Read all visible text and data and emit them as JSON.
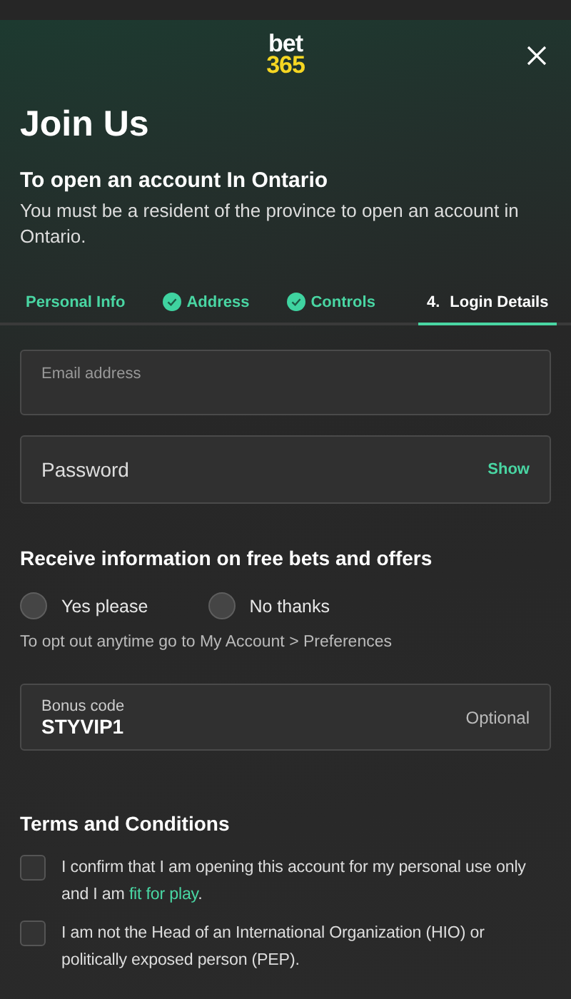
{
  "logo": {
    "line_1": "bet",
    "line_2": "365"
  },
  "title": "Join Us",
  "notice": {
    "heading": "To open an account In Ontario",
    "text": "You must be a resident of the province to open an account in Ontario."
  },
  "tabs": [
    {
      "label": "Personal Info",
      "checked": false,
      "selected": false
    },
    {
      "label": "Address",
      "checked": true,
      "selected": false
    },
    {
      "label": "Controls",
      "checked": true,
      "selected": false
    },
    {
      "label": "Login Details",
      "step": "4.",
      "checked": false,
      "selected": true
    }
  ],
  "email_field": {
    "placeholder": "Email address"
  },
  "password_field": {
    "placeholder": "Password",
    "toggle": "Show"
  },
  "offers": {
    "heading": "Receive information on free bets and offers",
    "options": [
      {
        "label": "Yes please",
        "selected": false
      },
      {
        "label": "No thanks",
        "selected": false
      }
    ],
    "note": "To opt out anytime go to My Account > Preferences"
  },
  "bonus_field": {
    "label": "Bonus code",
    "value": "STYVIP1",
    "hint": "Optional"
  },
  "terms": {
    "heading": "Terms and Conditions",
    "items": [
      {
        "text_before": "I confirm that I am opening this account for my personal use only and I am ",
        "link": "fit for play",
        "text_after": ".",
        "checked": false
      },
      {
        "text_before": "I am not the Head of an International Organization (HIO) or politically exposed person (PEP).",
        "checked": false
      }
    ]
  }
}
